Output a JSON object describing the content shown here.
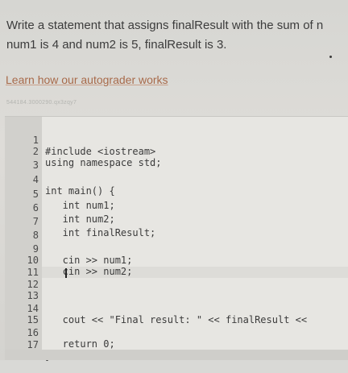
{
  "prompt": {
    "line1": "Write a statement that assigns finalResult with the sum of n",
    "line2": "num1 is 4 and num2 is 5, finalResult is 3."
  },
  "autograder_link": "Learn how our autograder works",
  "submission_id": "544184.3000290.qx3zqy7",
  "editor": {
    "lines": [
      {
        "num": "1",
        "code": "#include <iostream>"
      },
      {
        "num": "2",
        "code": "using namespace std;"
      },
      {
        "num": "3",
        "code": ""
      },
      {
        "num": "4",
        "code": "int main() {"
      },
      {
        "num": "5",
        "code": "   int num1;"
      },
      {
        "num": "6",
        "code": "   int num2;"
      },
      {
        "num": "7",
        "code": "   int finalResult;"
      },
      {
        "num": "8",
        "code": ""
      },
      {
        "num": "9",
        "code": "   cin >> num1;"
      },
      {
        "num": "10",
        "code": "   cin >> num2;"
      },
      {
        "num": "11",
        "code": ""
      },
      {
        "num": "12",
        "code": ""
      },
      {
        "num": "13",
        "code": ""
      },
      {
        "num": "14",
        "code": "   cout << \"Final result: \" << finalResult <<"
      },
      {
        "num": "15",
        "code": ""
      },
      {
        "num": "16",
        "code": "   return 0;"
      },
      {
        "num": "17",
        "code": "}"
      }
    ]
  }
}
